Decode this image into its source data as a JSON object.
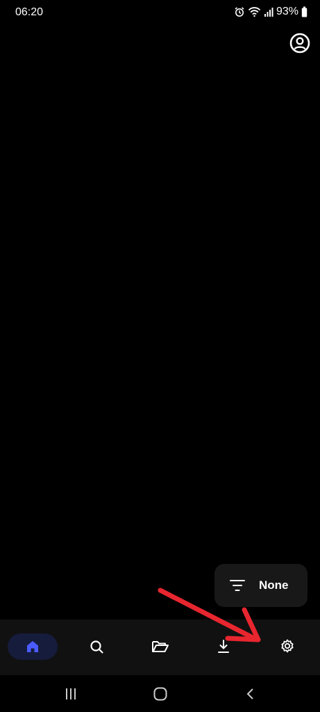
{
  "status_bar": {
    "time": "06:20",
    "battery_percent": "93%",
    "icons": [
      "alarm-icon",
      "wifi-icon",
      "signal-icon",
      "battery-icon"
    ]
  },
  "header": {
    "profile_icon": "account-circle-icon"
  },
  "filter_chip": {
    "label": "None",
    "icon": "filter-icon"
  },
  "bottom_nav": {
    "active_color": "#4a5cff",
    "items": [
      {
        "name": "home",
        "icon": "home-icon",
        "active": true
      },
      {
        "name": "search",
        "icon": "search-icon",
        "active": false
      },
      {
        "name": "library",
        "icon": "folder-open-icon",
        "active": false
      },
      {
        "name": "downloads",
        "icon": "download-icon",
        "active": false
      },
      {
        "name": "settings",
        "icon": "gear-icon",
        "active": false
      }
    ]
  },
  "system_nav": {
    "buttons": [
      "recents-icon",
      "home-circle-icon",
      "back-icon"
    ]
  },
  "annotation": {
    "type": "arrow",
    "color": "#e8262f",
    "points_to": "settings"
  }
}
